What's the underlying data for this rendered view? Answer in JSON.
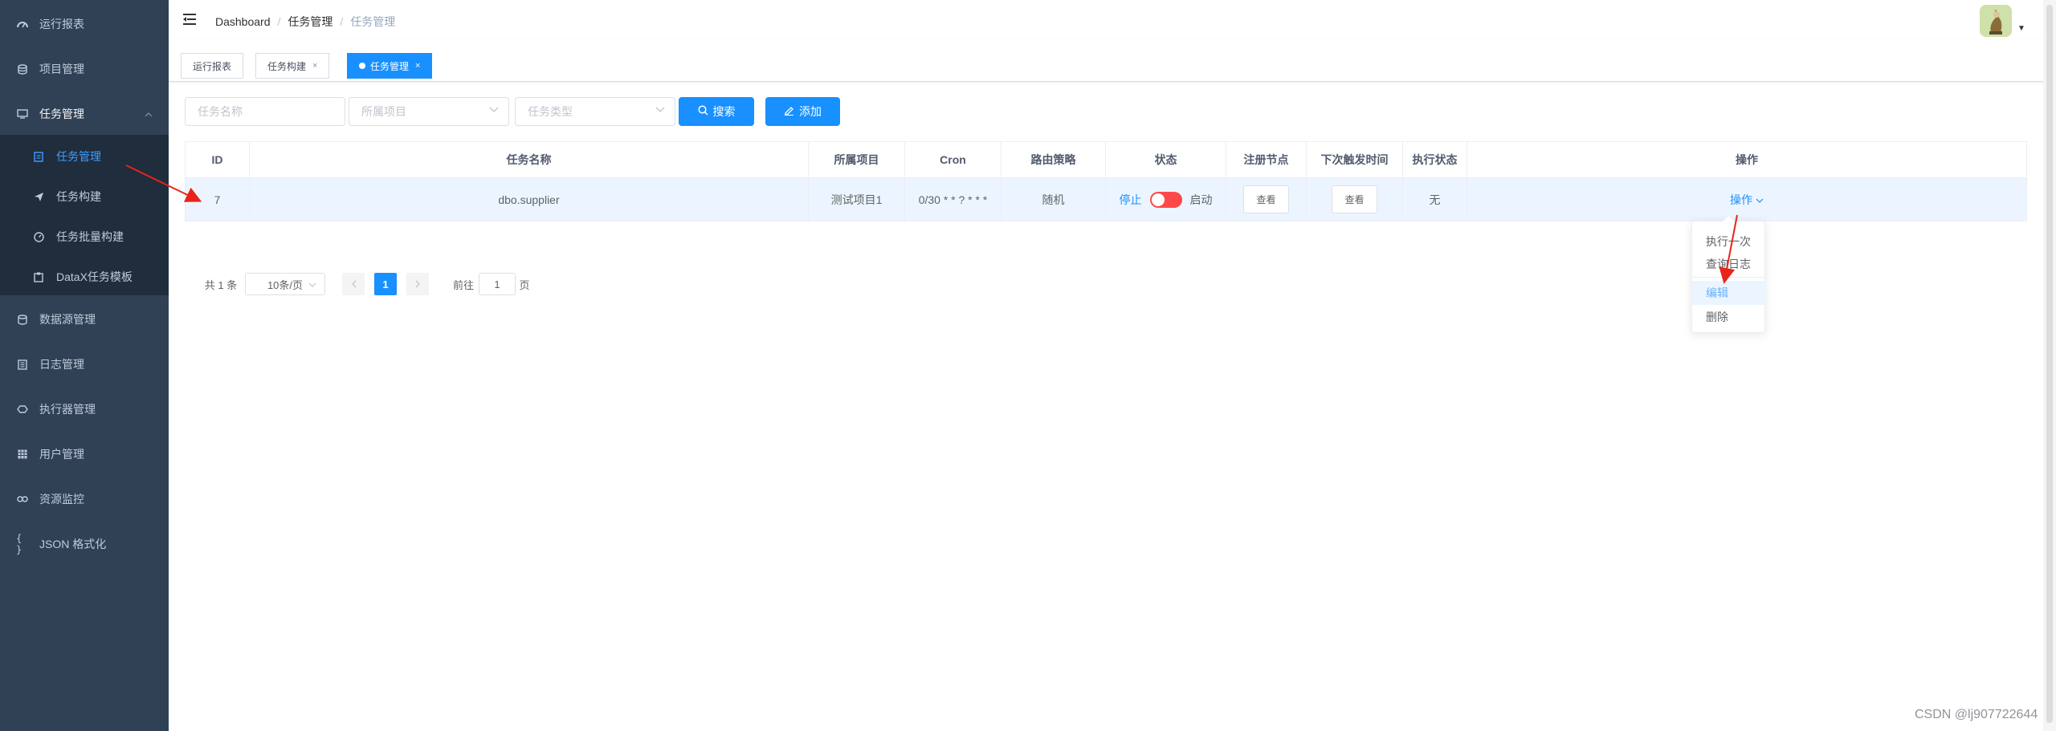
{
  "sidebar": {
    "items": [
      {
        "label": "运行报表",
        "icon": "dashboard-icon"
      },
      {
        "label": "项目管理",
        "icon": "database-icon"
      },
      {
        "label": "任务管理",
        "icon": "monitor-icon"
      },
      {
        "label": "数据源管理",
        "icon": "datasource-icon"
      },
      {
        "label": "日志管理",
        "icon": "document-icon"
      },
      {
        "label": "执行器管理",
        "icon": "executor-icon"
      },
      {
        "label": "用户管理",
        "icon": "table-icon"
      },
      {
        "label": "资源监控",
        "icon": "link-icon"
      },
      {
        "label": "JSON 格式化",
        "icon": "braces-icon"
      }
    ],
    "subitems": [
      {
        "label": "任务管理",
        "icon": "task-doc-icon"
      },
      {
        "label": "任务构建",
        "icon": "send-icon"
      },
      {
        "label": "任务批量构建",
        "icon": "gauge-icon"
      },
      {
        "label": "DataX任务模板",
        "icon": "template-icon"
      }
    ]
  },
  "breadcrumb": [
    "Dashboard",
    "任务管理",
    "任务管理"
  ],
  "tags": [
    {
      "label": "运行报表"
    },
    {
      "label": "任务构建",
      "close": "×"
    },
    {
      "label": "任务管理",
      "close": "×"
    }
  ],
  "filters": {
    "task_name_placeholder": "任务名称",
    "project_placeholder": "所属项目",
    "task_type_placeholder": "任务类型",
    "search_label": "搜索",
    "add_label": "添加"
  },
  "table": {
    "headers": [
      "ID",
      "任务名称",
      "所属项目",
      "Cron",
      "路由策略",
      "状态",
      "注册节点",
      "下次触发时间",
      "执行状态",
      "操作"
    ],
    "row": {
      "id": "7",
      "name": "dbo.supplier",
      "project": "测试项目1",
      "cron": "0/30 * * ? * * *",
      "route": "随机",
      "status_off": "停止",
      "status_on": "启动",
      "node_btn": "查看",
      "next_btn": "查看",
      "exec_status": "无",
      "op": "操作"
    }
  },
  "dropdown": [
    "执行一次",
    "查询日志",
    "编辑",
    "删除"
  ],
  "pagination": {
    "total": "共 1 条",
    "page_size": "10条/页",
    "current": "1",
    "goto_prefix": "前往",
    "goto_value": "1",
    "goto_suffix": "页"
  },
  "watermark": "CSDN @lj907722644",
  "colors": {
    "sidebar_bg": "#304156",
    "accent": "#1890ff",
    "switch_off": "#ff4949",
    "annotation": "#e8241a"
  }
}
